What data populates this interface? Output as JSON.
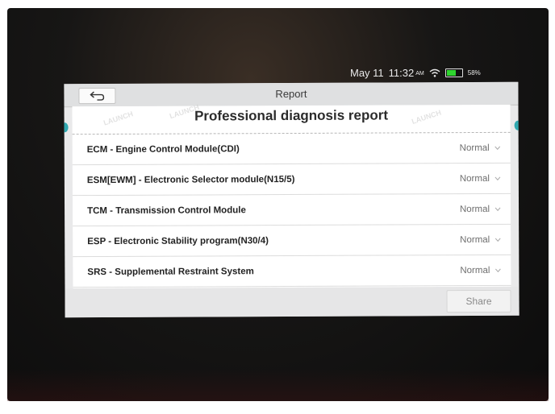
{
  "status_bar": {
    "date": "May 11",
    "time": "11:32",
    "ampm": "AM",
    "battery": "58%"
  },
  "header": {
    "title": "Report"
  },
  "report": {
    "heading": "Professional diagnosis report",
    "watermark": "LAUNCH",
    "rows": [
      {
        "label": "ECM - Engine Control Module(CDI)",
        "status": "Normal"
      },
      {
        "label": "ESM[EWM] - Electronic Selector module(N15/5)",
        "status": "Normal"
      },
      {
        "label": "TCM - Transmission Control Module",
        "status": "Normal"
      },
      {
        "label": "ESP - Electronic Stability program(N30/4)",
        "status": "Normal"
      },
      {
        "label": "SRS - Supplemental Restraint System",
        "status": "Normal"
      }
    ]
  },
  "footer": {
    "share_label": "Share"
  },
  "icons": {
    "back": "back-arrow-icon",
    "wifi": "wifi-icon",
    "battery": "battery-icon",
    "row_chevron": "chevron-down-icon"
  },
  "colors": {
    "accent": "#2fa8b0",
    "battery_fill": "#2fd52f"
  }
}
